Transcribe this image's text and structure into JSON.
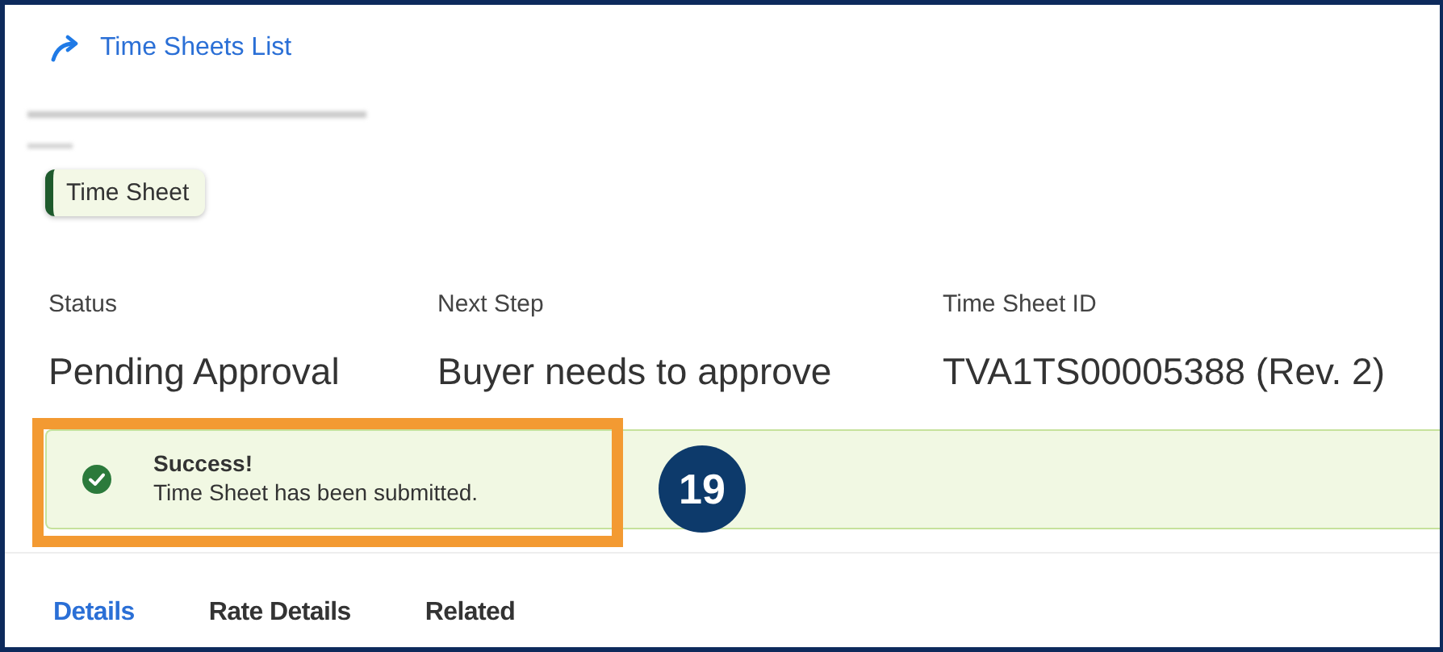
{
  "breadcrumb": {
    "label": "Time Sheets List"
  },
  "tag": {
    "label": "Time Sheet"
  },
  "fields": [
    {
      "label": "Status",
      "value": "Pending Approval"
    },
    {
      "label": "Next Step",
      "value": "Buyer needs to approve"
    },
    {
      "label": "Time Sheet ID",
      "value": "TVA1TS00005388 (Rev. 2)"
    }
  ],
  "message": {
    "title": "Success!",
    "text": "Time Sheet has been submitted."
  },
  "callout": {
    "number": "19"
  },
  "tabs": [
    {
      "label": "Details",
      "selected": true
    },
    {
      "label": "Rate Details",
      "selected": false
    },
    {
      "label": "Related",
      "selected": false
    }
  ]
}
